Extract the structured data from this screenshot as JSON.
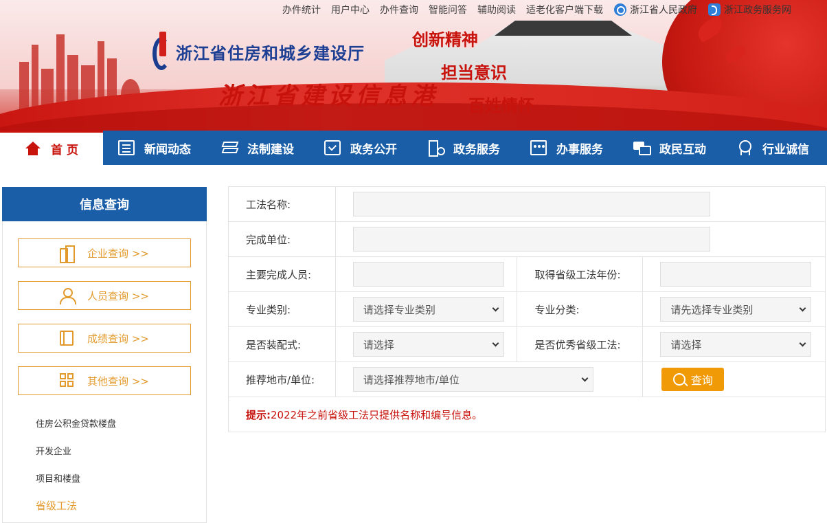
{
  "top_links": [
    "办件统计",
    "用户中心",
    "办件查询",
    "智能问答",
    "辅助阅读",
    "适老化客户端下载"
  ],
  "gov_links": [
    {
      "icon": "globe-icon",
      "label": "浙江省人民政府"
    },
    {
      "icon": "service-icon",
      "label": "浙江政务服务网"
    }
  ],
  "banner": {
    "department": "浙江省住房和城乡建设厅",
    "site_title": "浙江省建设信息港",
    "slogans": [
      "创新精神",
      "担当意识",
      "百姓情怀"
    ]
  },
  "nav": [
    {
      "label": "首 页",
      "icon": "home-icon",
      "active": true
    },
    {
      "label": "新闻动态",
      "icon": "news-icon"
    },
    {
      "label": "法制建设",
      "icon": "layers-icon"
    },
    {
      "label": "政务公开",
      "icon": "check-board-icon"
    },
    {
      "label": "政务服务",
      "icon": "service-gear-icon"
    },
    {
      "label": "办事服务",
      "icon": "people-board-icon"
    },
    {
      "label": "政民互动",
      "icon": "chat-icon"
    },
    {
      "label": "行业诚信",
      "icon": "medal-icon"
    }
  ],
  "sidebar": {
    "title": "信息查询",
    "buttons": [
      {
        "label": "企业查询 >>",
        "icon": "building-icon"
      },
      {
        "label": "人员查询 >>",
        "icon": "user-icon"
      },
      {
        "label": "成绩查询 >>",
        "icon": "book-icon"
      },
      {
        "label": "其他查询 >>",
        "icon": "grid-icon"
      }
    ],
    "links": [
      "住房公积金贷款楼盘",
      "开发企业",
      "项目和楼盘",
      "省级工法"
    ],
    "active_link": "省级工法"
  },
  "form": {
    "method_name_label": "工法名称:",
    "completion_unit_label": "完成单位:",
    "main_personnel_label": "主要完成人员:",
    "year_label": "取得省级工法年份:",
    "category_label": "专业类别:",
    "category_value": "请选择专业类别",
    "subcategory_label": "专业分类:",
    "subcategory_value": "请先选择专业类别",
    "prefab_label": "是否装配式:",
    "prefab_value": "请选择",
    "excellent_label": "是否优秀省级工法:",
    "excellent_value": "请选择",
    "recommend_label": "推荐地市/单位:",
    "recommend_value": "请选择推荐地市/单位",
    "search_label": "查询",
    "tip_prefix": "提示:",
    "tip_text": "2022年之前省级工法只提供名称和编号信息。"
  },
  "colors": {
    "nav_blue": "#1a5ea8",
    "accent_red": "#c8130d",
    "accent_orange": "#e39a2c",
    "button_orange": "#f19a08"
  }
}
